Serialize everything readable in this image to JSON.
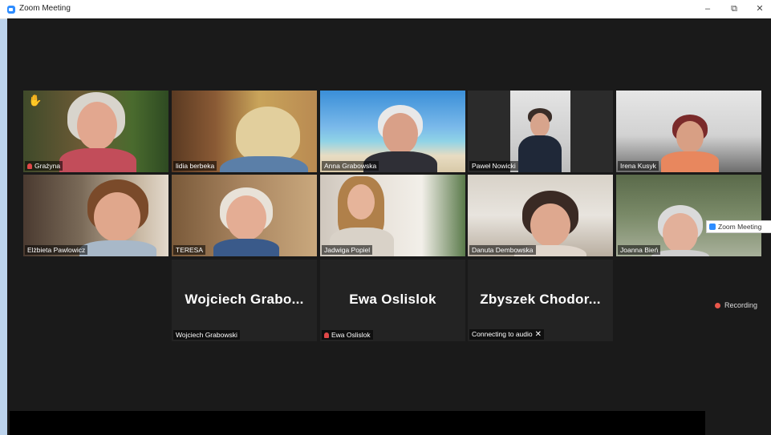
{
  "window": {
    "title": "Zoom Meeting",
    "minimize_glyph": "–",
    "restore_glyph": "⧉",
    "close_glyph": "✕"
  },
  "participants": [
    {
      "name": "Grażyna",
      "muted": true,
      "hand_raised": true
    },
    {
      "name": "lidia berbeka"
    },
    {
      "name": "Anna Grabowska"
    },
    {
      "name": "Paweł Nowicki"
    },
    {
      "name": "Irena Kusyk"
    },
    {
      "name": "Elżbieta Pawlowicz",
      "active_speaker": true
    },
    {
      "name": "TERESA"
    },
    {
      "name": "Jadwiga Popiel"
    },
    {
      "name": "Danuta Dembowska"
    },
    {
      "name": "Joanna Bień"
    }
  ],
  "name_tiles": [
    {
      "display": "Wojciech  Grabo...",
      "tag": "Wojciech Grabowski"
    },
    {
      "display": "Ewa Oslislok",
      "tag": "Ewa Oslislok",
      "muted": true
    },
    {
      "display": "Zbyszek  Chodor...",
      "tag": "Connecting to audio",
      "close_glyph": "✕"
    }
  ],
  "float_badge": "Zoom Meeting",
  "recording": "Recording",
  "colors": {
    "accent": "#2d8cff",
    "active_border": "#d7d76a",
    "recording": "#e8564a"
  }
}
